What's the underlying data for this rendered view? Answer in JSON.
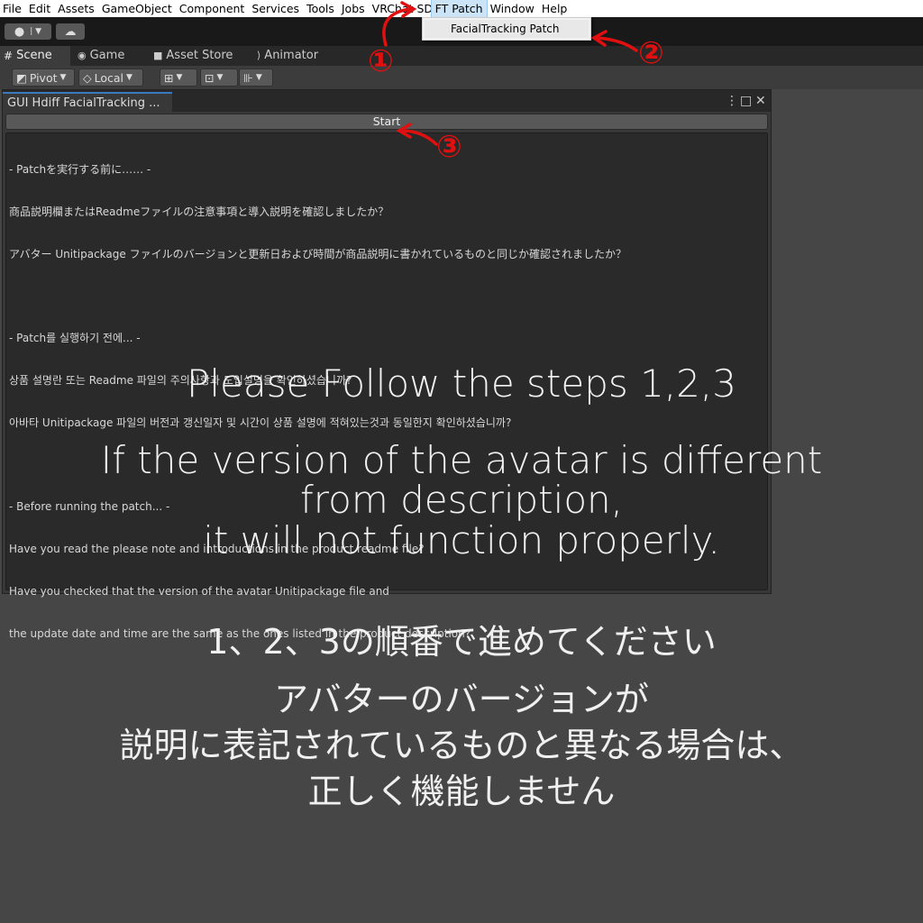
{
  "menubar": {
    "items": [
      "File",
      "Edit",
      "Assets",
      "GameObject",
      "Component",
      "Services",
      "Tools",
      "Jobs",
      "VRChat SDK",
      "FT Patch",
      "Window",
      "Help"
    ],
    "active": "FT Patch"
  },
  "dropdown": {
    "item": "FacialTracking Patch"
  },
  "tabs": {
    "scene": "Scene",
    "game": "Game",
    "asset_store": "Asset Store",
    "animator": "Animator"
  },
  "scene_toolbar": {
    "pivot": "Pivot",
    "local": "Local"
  },
  "window": {
    "title": "GUI Hdiff FacialTracking ...",
    "start_label": "Start",
    "text_lines": [
      "- Patchを実行する前に…… -",
      "商品説明欄またはReadmeファイルの注意事項と導入説明を確認しましたか？",
      "アバター Unitipackage ファイルのバージョンと更新日および時間が商品説明に書かれているものと同じか確認されましたか？",
      "",
      "- Patch를 실행하기 전에... -",
      "상품 설명란 또는 Readme 파일의 주의사항과 도입설명을 확인하셨습니까?",
      "아바타 Unitipackage 파일의 버전과 갱신일자 및 시간이 상품 설명에 적혀있는것과 동일한지 확인하셨습니까?",
      "",
      "- Before running the patch... -",
      "Have you read the please note and introductions in the product readme file?",
      "Have you checked that the version of the avatar Unitipackage file and",
      "the update date and time are the same as the ones listed in the product description?"
    ]
  },
  "overlay_en": {
    "line1": "Please Follow the steps 1,2,3",
    "line2": "If the version of the avatar is different",
    "line3": "from description,",
    "line4": "it will not function properly."
  },
  "overlay_jp": {
    "line1": "1、2、3の順番で進めてください",
    "line2": "アバターのバージョンが",
    "line3": "説明に表記されているものと異なる場合は、",
    "line4": "正しく機能しません"
  },
  "markers": {
    "one": "①",
    "two": "②",
    "three": "③"
  },
  "colors": {
    "marker": "#e01010",
    "accent": "#3a79bb"
  }
}
